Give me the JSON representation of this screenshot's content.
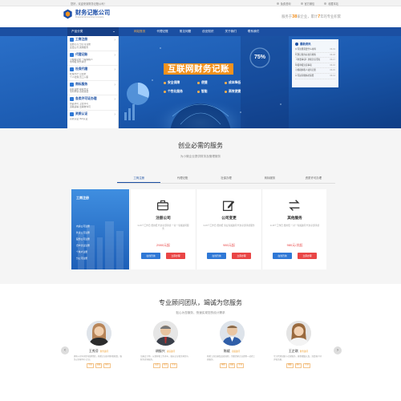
{
  "topbar": {
    "welcome": "您好，欢迎来到财务记账公司！",
    "phone": "免费咨询",
    "service": "官方微信",
    "collect": "收藏本站"
  },
  "header": {
    "brand": "财务记账公司",
    "brand_en": "Financial Accounting Company",
    "slogan_a": "服务于",
    "slogan_n1": "38",
    "slogan_b": "家企业，累计",
    "slogan_n2": "7",
    "slogan_c": "年的专业积累"
  },
  "nav": {
    "category": "产品分类",
    "items": [
      "网站首页",
      "代理记账",
      "常见问题",
      "创业知识",
      "关于我们",
      "联系我们"
    ]
  },
  "side": [
    {
      "title": "工商注册",
      "sub": "注册公司  分公司注册\n变更公司  其他服务"
    },
    {
      "title": "代理记账",
      "sub": "小规模记账  一般纳税人\n零申报  财务审计"
    },
    {
      "title": "社保代缴",
      "sub": "社保开户  公积金\n个人社保  员工入职"
    },
    {
      "title": "商标服务",
      "sub": "商标注册  版权登记\n专利申请  商标续展"
    },
    {
      "title": "各类许可证办理",
      "sub": "食品许可  卫生许可\n道路运输  出版物许可"
    },
    {
      "title": "资质认证",
      "sub": "高新认证  ISO认证"
    }
  ],
  "banner": {
    "title": "互联网财务记账",
    "pct": "75%",
    "tags": [
      "安全保障",
      "便捷",
      "成本降低",
      "个性化服务",
      "智能",
      "高效便捷"
    ]
  },
  "news": {
    "title": "最新资讯",
    "items": [
      {
        "t": "公司注册需要什么材料",
        "d": "06-19"
      },
      {
        "t": "代理记账的好处有哪些",
        "d": "06-18"
      },
      {
        "t": "【重要事项】新规企业须知",
        "d": "06-17"
      },
      {
        "t": "年报申报注意事项",
        "d": "06-16"
      },
      {
        "t": "小规模纳税人如何记账",
        "d": "06-15"
      },
      {
        "t": "公司如何缴纳社保费",
        "d": "06-14"
      }
    ]
  },
  "sec1": {
    "title": "创业必需的服务",
    "sub": "为小微企业提供财务及管理服务",
    "tabs": [
      "工商注册",
      "代理记账",
      "社保办理",
      "商标服务",
      "资质许可办理"
    ]
  },
  "bluecard": {
    "title": "工商注册",
    "items": [
      "内资公司注册",
      "外资公司注册",
      "股份公司注册",
      "合伙企业注册",
      "个体户注册",
      "分公司注册"
    ]
  },
  "cards": [
    {
      "name": "注册公司",
      "desc": "3-15个工作日 费用低 代办全部手续 一对一专属顾问服务",
      "price": "2980元起",
      "b1": "在线咨询",
      "b2": "立即办理"
    },
    {
      "name": "公司变更",
      "desc": "3-15个工作日 费用低 专业专属顾问 代办全部手续服务",
      "price": "980元起",
      "b1": "在线咨询",
      "b2": "立即办理"
    },
    {
      "name": "其他服务",
      "desc": "3-15个工作日 费用低 一对一专属顾问 代办全部手续",
      "price": "980元/次起",
      "b1": "在线咨询",
      "b2": "立即办理"
    }
  ],
  "sec2": {
    "title": "专业顾问团队，竭诚为您服务",
    "sub": "贴心为您服务，快速实现您的设计需求"
  },
  "team": [
    {
      "name": "王秀芬",
      "role": "财务顾问",
      "desc": "拥有十余年财务管理经验，熟悉企业各项财税政策，服务过多家中小企业。",
      "tags": [
        "专业",
        "高效",
        "耐心"
      ]
    },
    {
      "name": "胡振兴",
      "role": "资深顾问",
      "desc": "注册会计师，从事财税工作多年，擅长企业税务筹划与财务咨询服务。",
      "tags": [
        "认真",
        "负责",
        "专业"
      ]
    },
    {
      "name": "陈斌",
      "role": "高级顾问",
      "desc": "熟悉工商注册及变更流程，为数百家企业提供一站式工商服务。",
      "tags": [
        "热情",
        "高效",
        "专业"
      ]
    },
    {
      "name": "王芷琪",
      "role": "财务顾问",
      "desc": "专注代理记账与社保服务，做事细致认真，深受客户好评和信赖。",
      "tags": [
        "细致",
        "耐心",
        "专业"
      ]
    }
  ]
}
